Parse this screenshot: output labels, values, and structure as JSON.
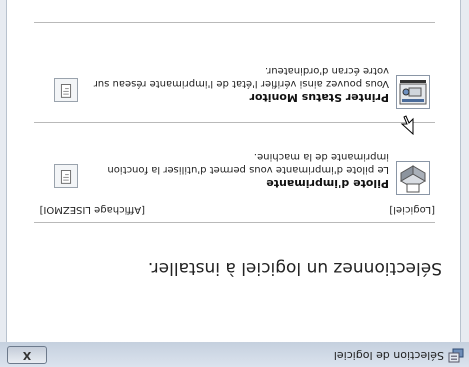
{
  "window": {
    "title": "Sélection de logiciel",
    "close_label": "X"
  },
  "main": {
    "heading": "Sélectionnez un logiciel à installer.",
    "columns": {
      "left": "[Logiciel]",
      "right": "[Affichage LISEZMOI]"
    },
    "items": [
      {
        "title": "Pilote d'imprimante",
        "description": "Le pilote d'imprimante vous permet d'utiliser la fonction imprimante de la machine."
      },
      {
        "title": "Printer Status Monitor",
        "description": "Vous pouvez ainsi vérifier l'état de l'imprimante réseau sur votre écran d'ordinateur."
      }
    ]
  }
}
